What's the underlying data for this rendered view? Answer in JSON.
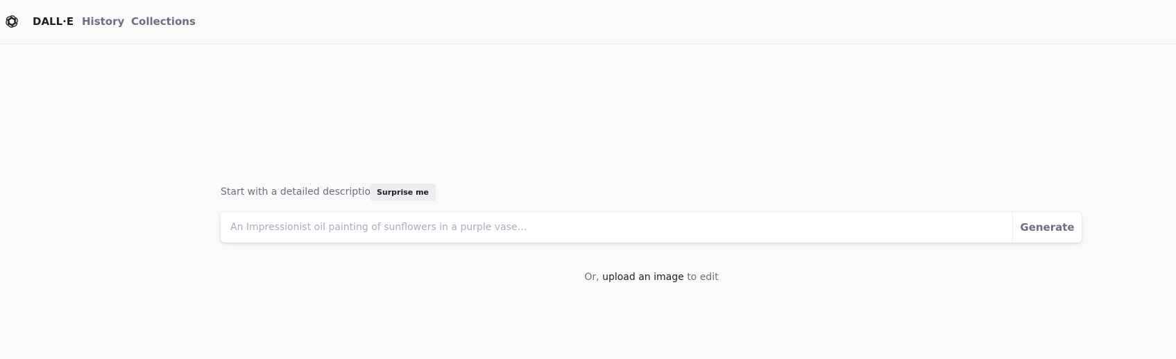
{
  "header": {
    "logo_icon": "openai-logo-icon",
    "brand": "DALL·E",
    "nav": {
      "history": "History",
      "collections": "Collections"
    }
  },
  "prompt": {
    "label": "Start with a detailed description",
    "surprise_label": "Surprise me",
    "value": "",
    "placeholder": "An Impressionist oil painting of sunflowers in a purple vase…",
    "generate_label": "Generate"
  },
  "upload": {
    "prefix": "Or,",
    "link": "upload an image",
    "suffix": "to edit"
  },
  "colors": {
    "background": "#fafafb",
    "text_primary": "#202123",
    "text_muted": "#6e6e80",
    "placeholder": "#acacbe",
    "chip_bg": "#ececf1"
  }
}
